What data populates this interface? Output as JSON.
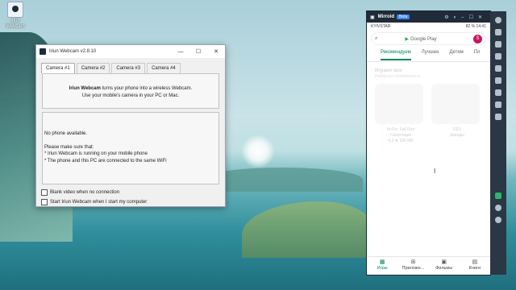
{
  "desktop": {
    "icon_label": "Iriun Webcam"
  },
  "iriun": {
    "title": "Iriun Webcam v2.8.10",
    "tabs": [
      "Camera #1",
      "Camera #2",
      "Camera #3",
      "Camera #4"
    ],
    "brand": "Iriun Webcam",
    "intro_rest": " turns your phone into a wireless Webcam.",
    "intro_line2": "Use your mobile's camera in your PC or Mac.",
    "no_phone": "No phone available.",
    "make_sure": "Please make sure that:",
    "bullet1": "* Iriun Webcam is running on your mobile phone",
    "bullet2": "* The phone and this PC are connected to the same WiFi",
    "check_blank": "Blank video when no connection",
    "check_start": "Start Iriun Webcam when I start my computer"
  },
  "mirroid": {
    "title": "Mirroid",
    "badge": "Beta",
    "status_left": "KYIVSTAR",
    "status_right": "82 %  14:41",
    "search_label": "Google Play",
    "avatar": "S",
    "tabs": [
      "Рекомендуем",
      "Лучшее",
      "Детям",
      "Пл"
    ],
    "section_title": "Играют все",
    "section_sub": "Набирают популярность",
    "card1_line1": "Hi-Fly: Fall Run",
    "card1_line2": "Симуляция",
    "card1_line3": "4,3 ★  100 МБ",
    "card2_line1": "DEV",
    "card2_line2": "Аркады",
    "nav": [
      {
        "icon": "▦",
        "label": "Игры"
      },
      {
        "icon": "⊞",
        "label": "Приложе..."
      },
      {
        "icon": "▣",
        "label": "Фильмы"
      },
      {
        "icon": "▤",
        "label": "Книги"
      }
    ]
  }
}
